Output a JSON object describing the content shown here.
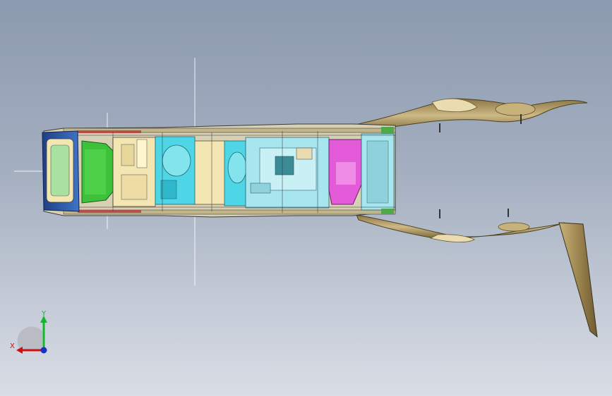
{
  "viewport": {
    "background_top": "#8c9aaf",
    "background_bottom": "#d9dde5"
  },
  "model": {
    "component_colors": {
      "cab_frame": "#2f5fae",
      "seat": "#3dc13a",
      "panel_cream": "#f3e6b2",
      "bracket_cyan": "#4fd6e6",
      "console_lightblue": "#a7e6ee",
      "cover_magenta": "#e35bd9",
      "tray_teal": "#4fb4a8",
      "bumper_red": "#b45050",
      "wing_bronze": "#9e8650",
      "wing_highlight": "#e8dcb0"
    }
  },
  "triad": {
    "x_label": "X",
    "y_label": "Y",
    "x_color": "#cc1010",
    "y_color": "#12b82a",
    "z_color": "#1a2fcc"
  }
}
